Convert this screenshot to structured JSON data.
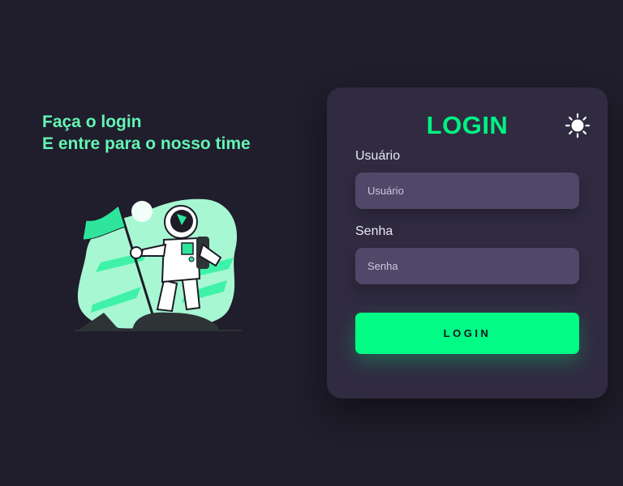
{
  "hero": {
    "line1": "Faça o login",
    "line2": "E entre para o nosso time"
  },
  "illustration": {
    "icon": "astronaut-with-flag-illustration"
  },
  "login_card": {
    "title": "LOGIN",
    "theme_toggle_icon": "sun-icon",
    "username": {
      "label": "Usuário",
      "placeholder": "Usuário",
      "value": ""
    },
    "password": {
      "label": "Senha",
      "placeholder": "Senha",
      "value": ""
    },
    "submit_label": "LOGIN"
  },
  "colors": {
    "background": "#201d2c",
    "card": "#302b41",
    "input": "#514768",
    "accent": "#00fb85",
    "headline": "#63f5b4"
  }
}
